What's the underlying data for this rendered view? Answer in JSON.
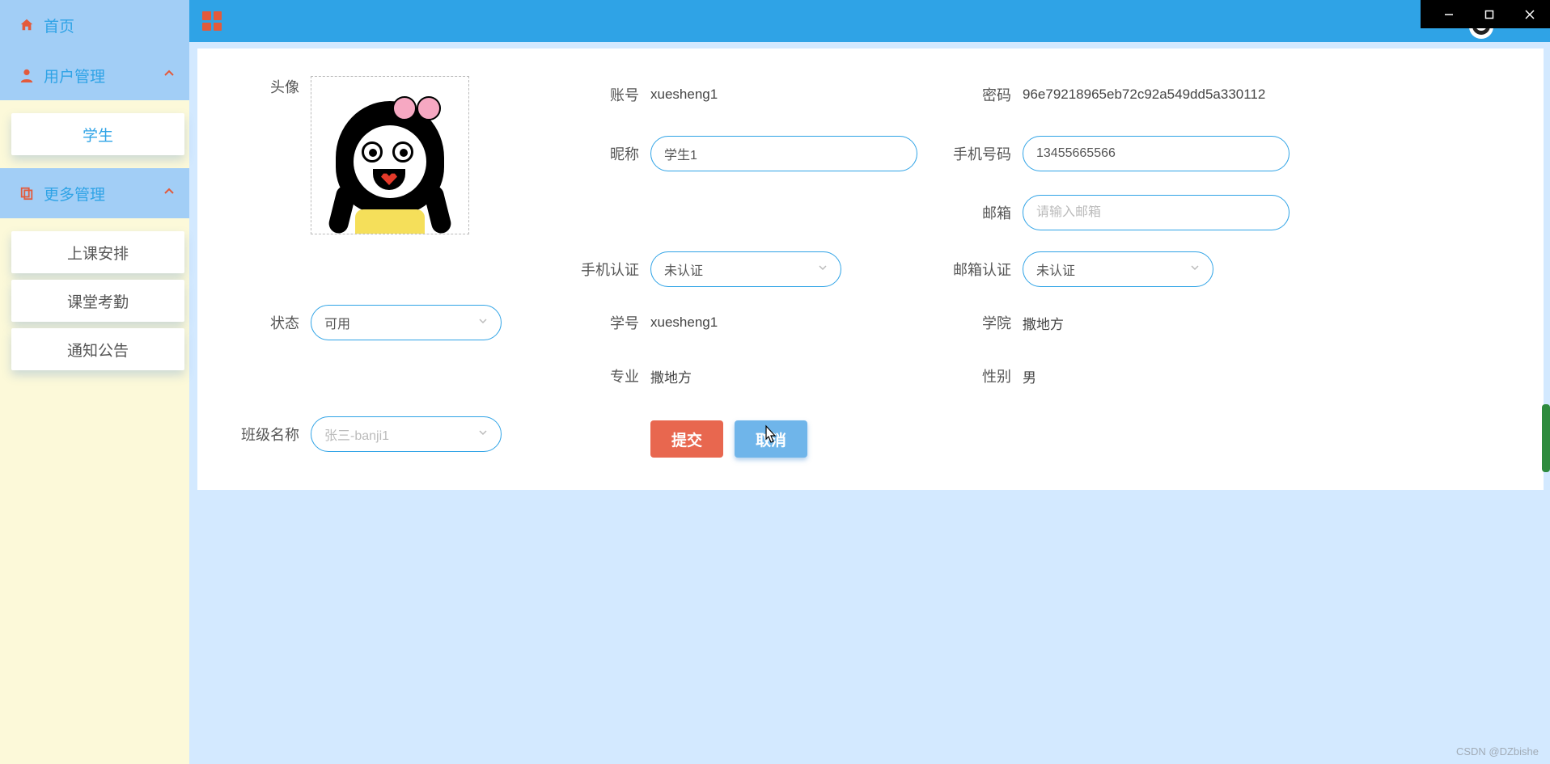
{
  "window": {
    "minimize": "minimize",
    "maximize": "maximize",
    "close": "close"
  },
  "sidebar": {
    "home": "首页",
    "user_mgmt": "用户管理",
    "more_mgmt": "更多管理",
    "user_items": {
      "student": "学生"
    },
    "more_items": {
      "schedule": "上课安排",
      "attendance": "课堂考勤",
      "announce": "通知公告"
    }
  },
  "form": {
    "labels": {
      "avatar": "头像",
      "account": "账号",
      "password": "密码",
      "nickname": "昵称",
      "phone": "手机号码",
      "email": "邮箱",
      "phone_verify": "手机认证",
      "email_verify": "邮箱认证",
      "status": "状态",
      "student_no": "学号",
      "college": "学院",
      "major": "专业",
      "gender": "性别",
      "class_name": "班级名称"
    },
    "values": {
      "account": "xuesheng1",
      "password": "96e79218965eb72c92a549dd5a330112",
      "nickname": "学生1",
      "phone": "13455665566",
      "email": "",
      "email_placeholder": "请输入邮箱",
      "phone_verify": "未认证",
      "email_verify": "未认证",
      "status": "可用",
      "student_no": "xuesheng1",
      "college": "撒地方",
      "major": "撒地方",
      "gender": "男",
      "class_name": "张三-banji1"
    },
    "buttons": {
      "submit": "提交",
      "cancel": "取消"
    }
  },
  "watermark": "CSDN @DZbishe"
}
